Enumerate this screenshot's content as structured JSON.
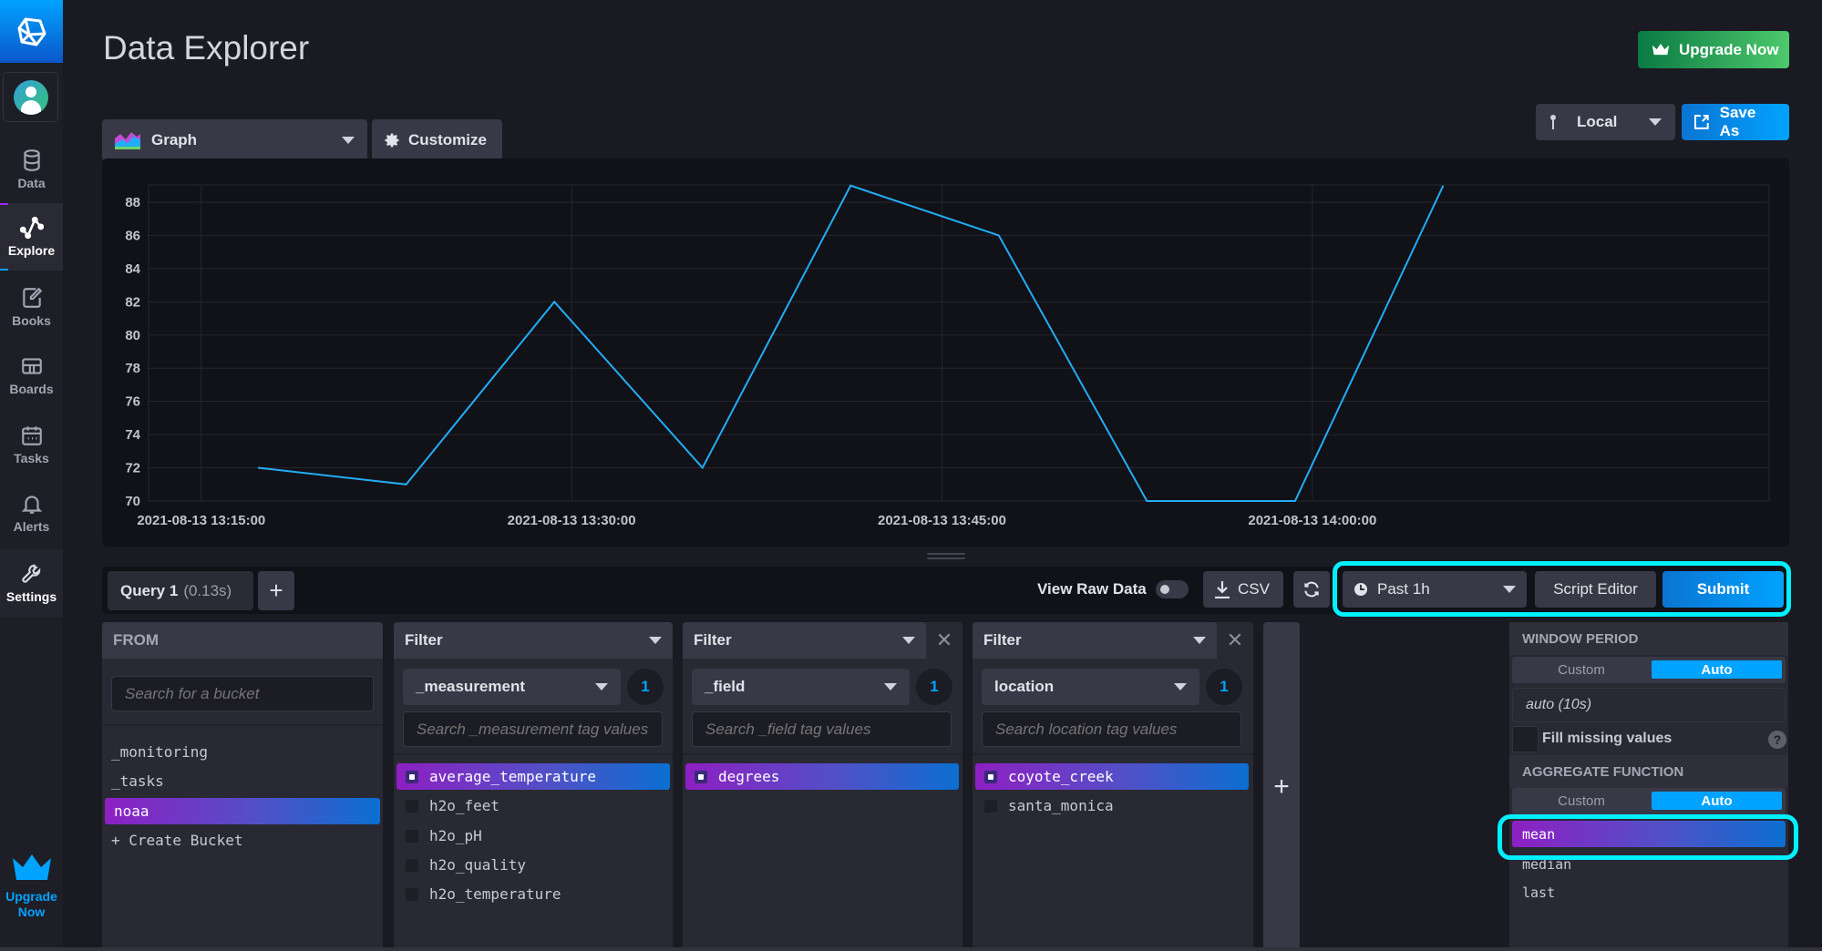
{
  "app": {
    "page_title": "Data Explorer"
  },
  "sidebar": {
    "items": [
      {
        "label": "Data",
        "icon": "database-icon",
        "active": false
      },
      {
        "label": "Explore",
        "icon": "graph-icon",
        "active": true
      },
      {
        "label": "Books",
        "icon": "notebook-icon",
        "active": false
      },
      {
        "label": "Boards",
        "icon": "dashboard-icon",
        "active": false
      },
      {
        "label": "Tasks",
        "icon": "calendar-icon",
        "active": false
      },
      {
        "label": "Alerts",
        "icon": "bell-icon",
        "active": false
      },
      {
        "label": "Settings",
        "icon": "wrench-icon",
        "active": false
      }
    ],
    "upgrade_line1": "Upgrade",
    "upgrade_line2": "Now"
  },
  "header": {
    "upgrade_label": "Upgrade Now",
    "vis_type": "Graph",
    "customize_label": "Customize",
    "timezone": "Local",
    "save_as_label": "Save As"
  },
  "query_bar": {
    "tab_name": "Query 1",
    "tab_time": "(0.13s)",
    "add_label": "+",
    "raw_data_label": "View Raw Data",
    "raw_data_on": false,
    "csv_label": "CSV",
    "time_range": "Past 1h",
    "script_editor_label": "Script Editor",
    "submit_label": "Submit"
  },
  "builder": {
    "from": {
      "title": "FROM",
      "search_placeholder": "Search for a bucket",
      "buckets": [
        "_monitoring",
        "_tasks",
        "noaa"
      ],
      "selected": "noaa",
      "create_label": "+ Create Bucket"
    },
    "filters": [
      {
        "title": "Filter",
        "key": "_measurement",
        "count": "1",
        "search_placeholder": "Search _measurement tag values",
        "values": [
          {
            "label": "average_temperature",
            "selected": true
          },
          {
            "label": "h2o_feet",
            "selected": false
          },
          {
            "label": "h2o_pH",
            "selected": false
          },
          {
            "label": "h2o_quality",
            "selected": false
          },
          {
            "label": "h2o_temperature",
            "selected": false
          }
        ]
      },
      {
        "title": "Filter",
        "key": "_field",
        "count": "1",
        "search_placeholder": "Search _field tag values",
        "values": [
          {
            "label": "degrees",
            "selected": true
          }
        ]
      },
      {
        "title": "Filter",
        "key": "location",
        "count": "1",
        "search_placeholder": "Search location tag values",
        "values": [
          {
            "label": "coyote_creek",
            "selected": true
          },
          {
            "label": "santa_monica",
            "selected": false
          }
        ]
      }
    ],
    "add_filter_label": "+"
  },
  "aggregate": {
    "window_period_title": "WINDOW PERIOD",
    "custom_label": "Custom",
    "auto_label": "Auto",
    "window_value": "auto (10s)",
    "fill_missing_label": "Fill missing values",
    "fill_missing_checked": false,
    "help_label": "?",
    "aggregate_title": "AGGREGATE FUNCTION",
    "functions": [
      {
        "label": "mean",
        "selected": true
      },
      {
        "label": "median",
        "selected": false
      },
      {
        "label": "last",
        "selected": false
      }
    ]
  },
  "colors": {
    "accent": "#00a3ff",
    "line": "#22adf6",
    "highlight": "#00f0ff",
    "upgrade": "#34b45a"
  },
  "chart_data": {
    "type": "line",
    "title": "",
    "xlabel": "",
    "ylabel": "",
    "x": [
      "2021-08-13 13:17:18",
      "2021-08-13 13:23:18",
      "2021-08-13 13:29:18",
      "2021-08-13 13:35:18",
      "2021-08-13 13:41:18",
      "2021-08-13 13:47:18",
      "2021-08-13 13:53:18",
      "2021-08-13 13:59:18",
      "2021-08-13 14:05:18"
    ],
    "series": [
      {
        "name": "average_temperature degrees coyote_creek mean",
        "values": [
          72,
          71,
          82,
          72,
          89,
          86,
          70,
          70,
          89
        ]
      }
    ],
    "y_ticks": [
      70,
      72,
      74,
      76,
      78,
      80,
      82,
      84,
      86,
      88
    ],
    "ylim": [
      70,
      89
    ],
    "x_ticks": [
      "2021-08-13 13:15:00",
      "2021-08-13 13:30:00",
      "2021-08-13 13:45:00",
      "2021-08-13 14:00:00"
    ],
    "xlim": [
      "2021-08-13 13:12:52",
      "2021-08-13 14:18:30"
    ],
    "grid": true,
    "legend": "none"
  }
}
